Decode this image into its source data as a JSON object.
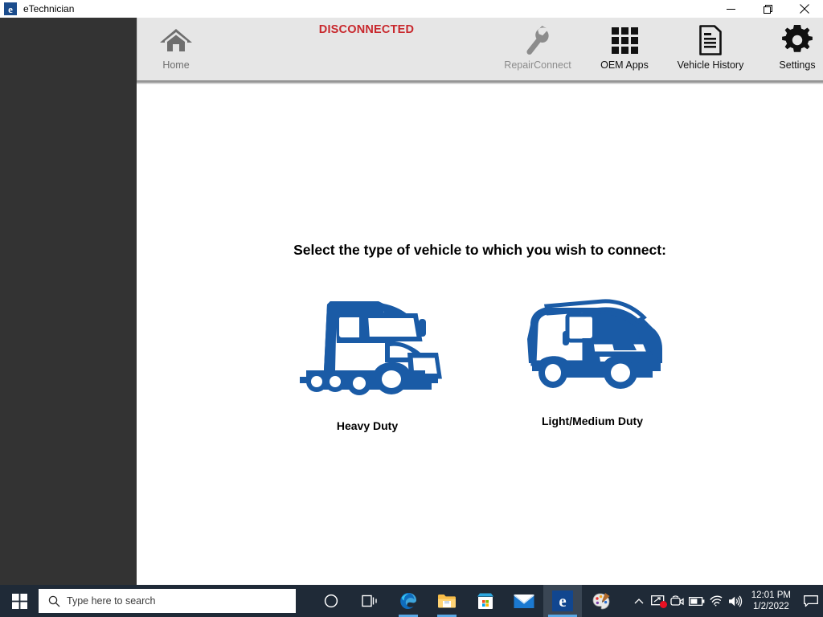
{
  "window": {
    "title": "eTechnician",
    "app_icon": "etechnician-e-icon",
    "app_icon_glyph": "e",
    "controls": {
      "minimize": "minimize-icon",
      "restore": "restore-icon",
      "close": "close-icon"
    }
  },
  "toolbar": {
    "status": "DISCONNECTED",
    "status_color": "#c8282d",
    "items": [
      {
        "label": "Home",
        "icon": "home-icon",
        "enabled": true
      },
      {
        "label": "RepairConnect",
        "icon": "wrench-icon",
        "enabled": false
      },
      {
        "label": "OEM Apps",
        "icon": "grid-apps-icon",
        "enabled": true
      },
      {
        "label": "Vehicle History",
        "icon": "document-lines-icon",
        "enabled": true
      },
      {
        "label": "Settings",
        "icon": "gear-icon",
        "enabled": true
      }
    ]
  },
  "main": {
    "prompt": "Select the type of vehicle to which you wish to connect:",
    "accent_color": "#1a5ba6",
    "choices": [
      {
        "label": "Heavy Duty",
        "icon": "semi-truck-icon"
      },
      {
        "label": "Light/Medium Duty",
        "icon": "cargo-van-icon"
      }
    ]
  },
  "taskbar": {
    "start": "windows-start-icon",
    "search": {
      "placeholder": "Type here to search",
      "icon": "search-icon"
    },
    "apps": [
      {
        "name": "cortana-icon",
        "running": false,
        "active": false
      },
      {
        "name": "task-view-icon",
        "running": false,
        "active": false
      },
      {
        "name": "microsoft-edge-icon",
        "running": true,
        "active": false
      },
      {
        "name": "file-explorer-icon",
        "running": true,
        "active": false
      },
      {
        "name": "microsoft-store-icon",
        "running": false,
        "active": false
      },
      {
        "name": "mail-icon",
        "running": false,
        "active": false
      },
      {
        "name": "etechnician-icon",
        "running": true,
        "active": true
      },
      {
        "name": "paint-icon",
        "running": false,
        "active": false
      }
    ],
    "tray": [
      {
        "name": "show-hidden-icons-chevron"
      },
      {
        "name": "remote-display-icon",
        "badge": true
      },
      {
        "name": "webcam-icon"
      },
      {
        "name": "battery-icon"
      },
      {
        "name": "wifi-icon"
      },
      {
        "name": "volume-icon"
      }
    ],
    "clock": {
      "time": "12:01 PM",
      "date": "1/2/2022"
    },
    "notification": "notification-center-icon"
  }
}
